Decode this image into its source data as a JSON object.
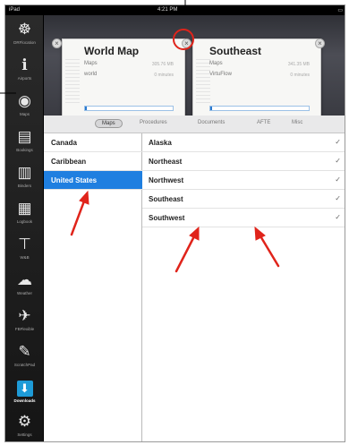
{
  "status_bar": {
    "left": "iPad",
    "time": "4:21 PM",
    "right": "▭"
  },
  "sidebar": {
    "items": [
      {
        "icon": "compass-icon",
        "glyph": "☸",
        "label": "DRFlocation"
      },
      {
        "icon": "info-icon",
        "glyph": "ℹ",
        "label": "Airports"
      },
      {
        "icon": "map-icon",
        "glyph": "◉",
        "label": "Maps"
      },
      {
        "icon": "bookshelf-icon",
        "glyph": "▤",
        "label": "Bookings"
      },
      {
        "icon": "document-icon",
        "glyph": "▥",
        "label": "Binders"
      },
      {
        "icon": "logbook-icon",
        "glyph": "▦",
        "label": "Logbook"
      },
      {
        "icon": "antenna-icon",
        "glyph": "⊤",
        "label": "W&B"
      },
      {
        "icon": "weather-icon",
        "glyph": "☁",
        "label": "Weather"
      },
      {
        "icon": "plane-icon",
        "glyph": "✈",
        "label": "FBFlexible"
      },
      {
        "icon": "document-sign-icon",
        "glyph": "✎",
        "label": "ScratchPad"
      },
      {
        "icon": "download-icon",
        "glyph": "⬇",
        "label": "Downloads"
      },
      {
        "icon": "gear-icon",
        "glyph": "⚙",
        "label": "Settings"
      }
    ]
  },
  "previews": [
    {
      "title": "World Map",
      "rows": [
        {
          "label": "Maps",
          "value": "305.76 MB"
        },
        {
          "label": "world",
          "value": "0 minutes"
        }
      ],
      "progress": 0.02
    },
    {
      "title": "Southeast",
      "rows": [
        {
          "label": "Maps",
          "value": "341.35 MB"
        },
        {
          "label": "VirtuFlow",
          "value": "0 minutes"
        }
      ],
      "progress": 0.02
    }
  ],
  "tabs": [
    "Maps",
    "Procedures",
    "Documents",
    "AFTE",
    "Misc"
  ],
  "regions": [
    "Canada",
    "Caribbean",
    "United States"
  ],
  "selected_region": "United States",
  "areas": [
    {
      "name": "Alaska",
      "check": "✓"
    },
    {
      "name": "Northeast",
      "check": "✓"
    },
    {
      "name": "Northwest",
      "check": "✓"
    },
    {
      "name": "Southeast",
      "check": "✓"
    },
    {
      "name": "Southwest",
      "check": "✓"
    }
  ],
  "colors": {
    "accent": "#1f7fe0",
    "annotation": "#e0241b"
  }
}
